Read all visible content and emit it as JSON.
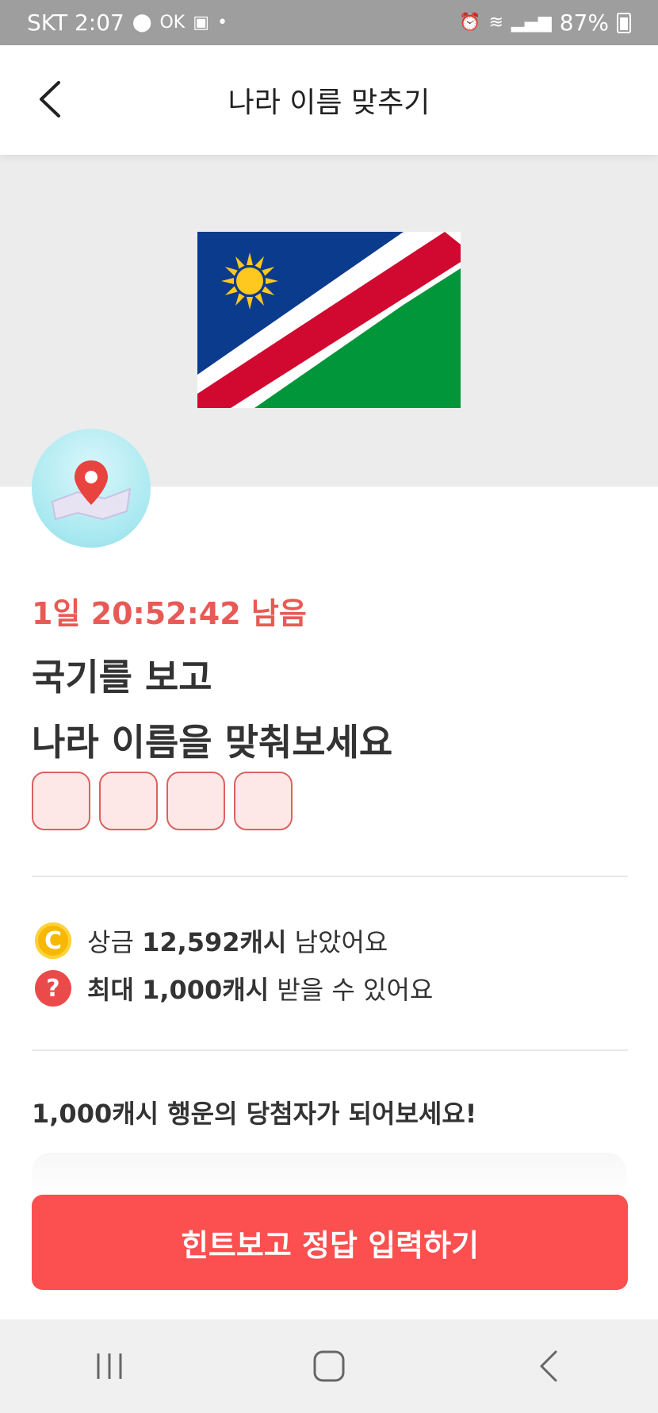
{
  "status_bar": {
    "carrier_time": "SKT 2:07",
    "left_icons": [
      "record-icon",
      "ok-icon",
      "app-icon",
      "dot-icon"
    ],
    "right_icons": [
      "alarm-icon",
      "wifi-icon",
      "signal-icon",
      "battery-charging-icon"
    ],
    "ok_text": "OK",
    "dot": "•",
    "battery": "87%"
  },
  "header": {
    "title": "나라 이름 맞추기"
  },
  "flag": {
    "country": "Namibia",
    "colors": {
      "blue": "#0b3b8c",
      "red": "#d1082f",
      "green": "#009639",
      "white": "#ffffff",
      "sun": "#ffc820"
    }
  },
  "quiz": {
    "timer": "1일 20:52:42 남음",
    "question_line1": "국기를 보고",
    "question_line2": "나라 이름을 맞춰보세요",
    "answer_box_count": 4
  },
  "info": {
    "prize_label": "상금",
    "prize_value": "12,592캐시",
    "prize_suffix": "남았어요",
    "prize_icon_text": "C",
    "max_label": "최대",
    "max_value": "1,000캐시",
    "max_suffix": "받을 수 있어요",
    "help_icon_text": "?"
  },
  "lucky": {
    "text": "1,000캐시 행운의 당첨자가 되어보세요!"
  },
  "cta": {
    "label": "힌트보고 정답 입력하기",
    "color": "#fc4f4f"
  },
  "accent": {
    "timer": "#e85a55"
  }
}
